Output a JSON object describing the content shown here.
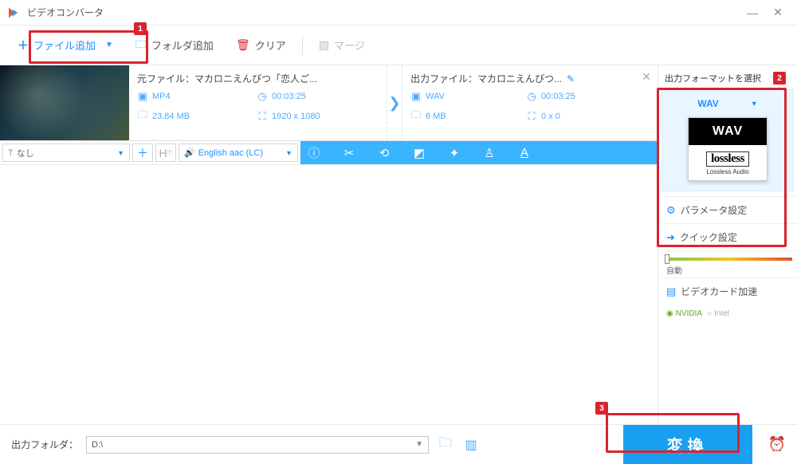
{
  "titlebar": {
    "title": "ビデオコンバータ"
  },
  "toolbar": {
    "add_file": "ファイル追加",
    "add_folder": "フォルダ追加",
    "clear": "クリア",
    "merge": "マージ"
  },
  "file": {
    "source_label_prefix": "元ファイル：",
    "source_name": "マカロニえんぴつ「恋人ご...",
    "source_format": "MP4",
    "source_duration": "00:03:25",
    "source_size": "23.84 MB",
    "source_res": "1920 x 1080",
    "output_label_prefix": "出力ファイル：",
    "output_name": "マカロニえんぴつ...",
    "output_format": "WAV",
    "output_duration": "00:03:25",
    "output_size": "6 MB",
    "output_res": "0 x 0"
  },
  "editbar": {
    "subtitle_none": "なし",
    "audio_track": "English aac (LC)"
  },
  "sidebar": {
    "title": "出力フォーマットを選択",
    "format_name": "WAV",
    "card_main": "WAV",
    "card_brand": "lossless",
    "card_sub": "Lossless Audio",
    "param": "パラメータ設定",
    "quick": "クイック設定",
    "slider_label": "自動",
    "gpu": "ビデオカード加速",
    "nvidia": "NVIDIA",
    "intel": "Intel"
  },
  "bottom": {
    "out_label": "出力フォルダ：",
    "out_path": "D:\\",
    "convert": "変換"
  },
  "badges": {
    "b1": "1",
    "b2": "2",
    "b3": "3"
  }
}
